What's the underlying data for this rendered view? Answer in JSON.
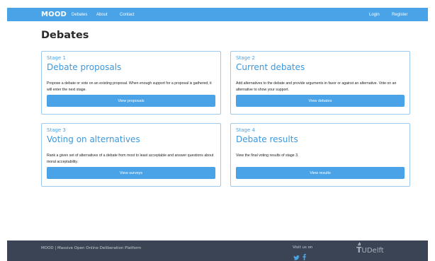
{
  "nav": {
    "brand": "MOOD",
    "links": [
      "Debates",
      "About",
      "Contact"
    ],
    "login": "Login",
    "register": "Register"
  },
  "page": {
    "title": "Debates"
  },
  "cards": [
    {
      "stage": "Stage 1",
      "title": "Debate proposals",
      "text": "Propose a debate or vote on an existing proposal. When enough support for a proposal is gathered, it will enter the next stage.",
      "button": "View proposals"
    },
    {
      "stage": "Stage 2",
      "title": "Current debates",
      "text": "Add alternatives to the debate and provide arguments in favor or against an alternative. Vote on an alternative to show your support.",
      "button": "View debates"
    },
    {
      "stage": "Stage 3",
      "title": "Voting on alternatives",
      "text": "Rank a given set of alternatives of a debate from most to least acceptable and answer questions about moral acceptability.",
      "button": "View surveys"
    },
    {
      "stage": "Stage 4",
      "title": "Debate results",
      "text": "View the final voting results of stage 3.",
      "button": "View results"
    }
  ],
  "footer": {
    "text": "MOOD | Massive Open Online Deliberation Platform",
    "visit": "Visit us on",
    "social_icons": [
      "twitter-icon",
      "facebook-icon"
    ],
    "logo_initial": "T",
    "logo_rest": "UDelft"
  },
  "colors": {
    "accent": "#4aa3e6",
    "footer_bg": "#3a4454",
    "card_border": "#9cc9ee"
  }
}
